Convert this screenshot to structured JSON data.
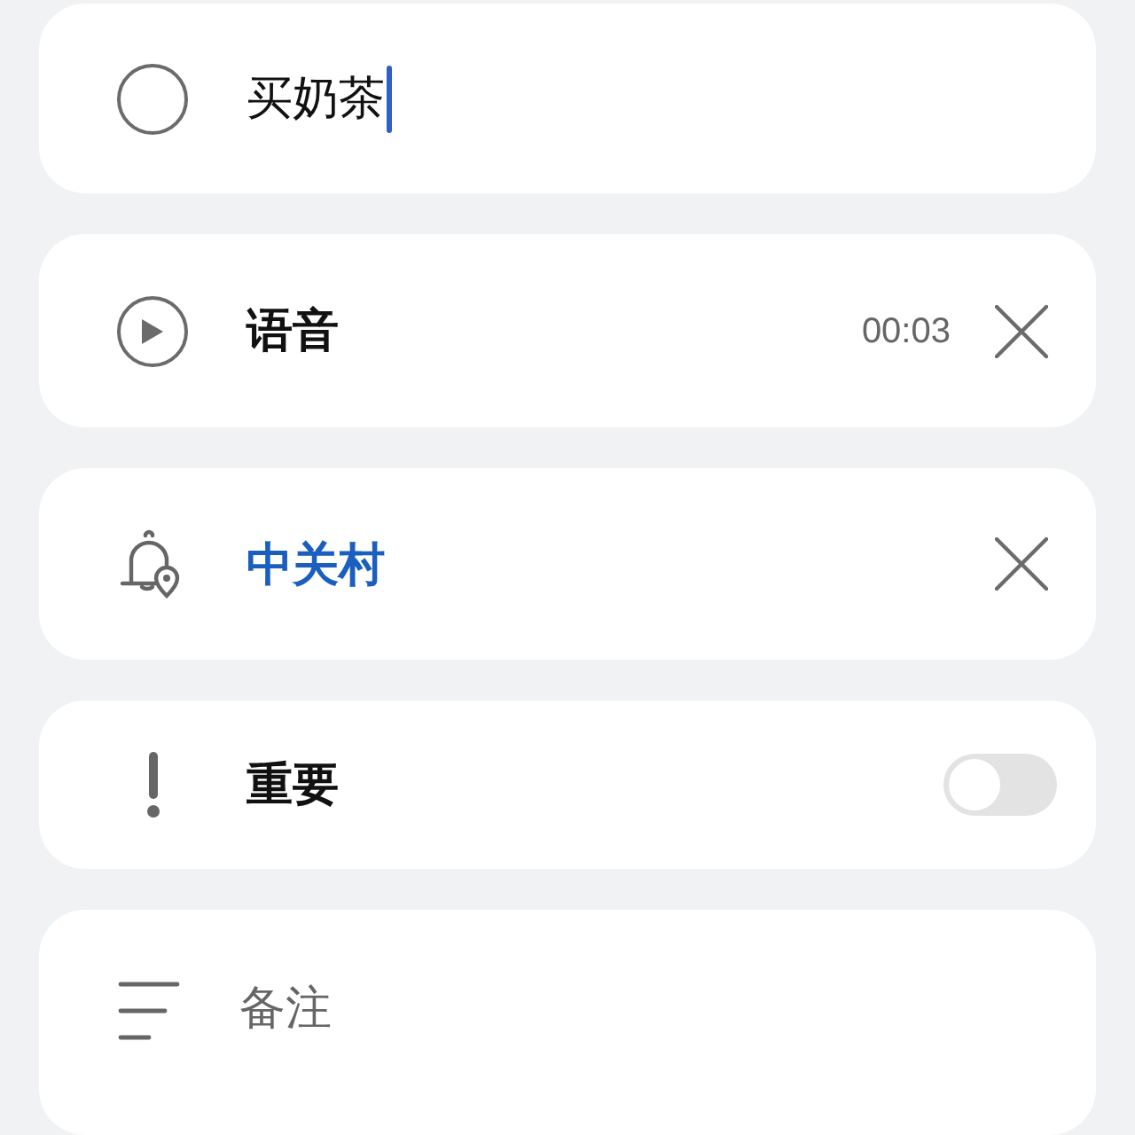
{
  "task": {
    "title": "买奶茶",
    "completed": false,
    "focused": true
  },
  "voice": {
    "label": "语音",
    "duration": "00:03"
  },
  "reminder": {
    "location": "中关村"
  },
  "important": {
    "label": "重要",
    "on": false
  },
  "note": {
    "placeholder": "备注"
  }
}
